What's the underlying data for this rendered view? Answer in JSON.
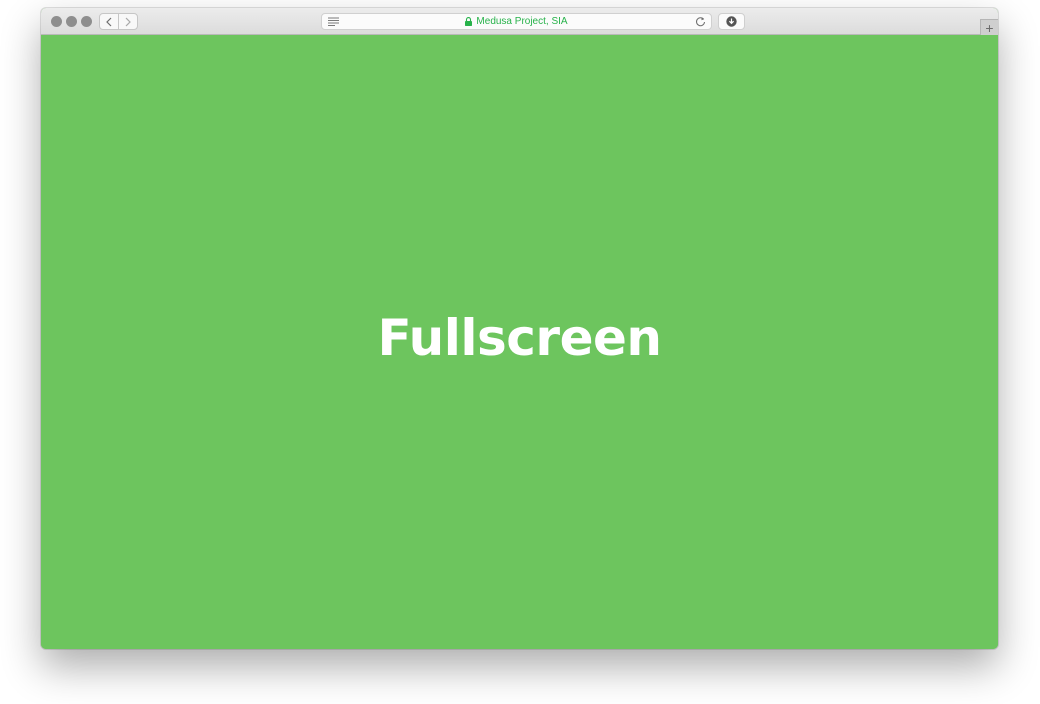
{
  "browser": {
    "address": "Medusa Project, SIA",
    "new_tab_label": "+",
    "url_color": "#27b24a"
  },
  "icons": {
    "back": "chevron-left-icon",
    "forward": "chevron-right-icon",
    "reader": "reader-icon",
    "lock": "lock-icon",
    "reload": "reload-icon",
    "download": "download-icon"
  },
  "page": {
    "headline": "Fullscreen",
    "background_color": "#6dc55e"
  }
}
